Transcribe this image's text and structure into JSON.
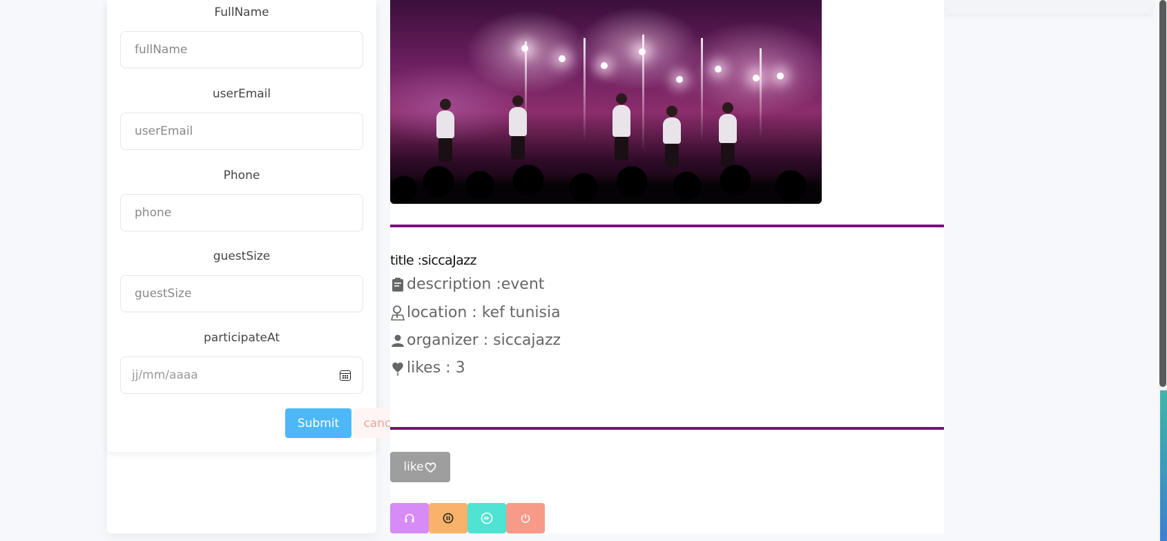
{
  "form": {
    "fields": [
      {
        "label": "FullName",
        "placeholder": "fullName"
      },
      {
        "label": "userEmail",
        "placeholder": "userEmail"
      },
      {
        "label": "Phone",
        "placeholder": "phone"
      },
      {
        "label": "guestSize",
        "placeholder": "guestSize"
      },
      {
        "label": "participateAt",
        "placeholder": "jj/mm/aaaa"
      }
    ],
    "submit_label": "Submit",
    "cancel_label": "cancle"
  },
  "event": {
    "image_alt": "concert",
    "title": "title :siccaJazz",
    "description": "description :event",
    "location": "location : kef tunisia",
    "organizer": "organizer : siccajazz",
    "likes": "likes : 3",
    "like_label": "like"
  },
  "media_controls": [
    {
      "icon": "headphones-icon",
      "color": "#d78bf5"
    },
    {
      "icon": "pause-icon",
      "color": "#f9b26b"
    },
    {
      "icon": "fast-forward-icon",
      "color": "#4ee3d2"
    },
    {
      "icon": "power-icon",
      "color": "#f79a88"
    }
  ],
  "colors": {
    "accent_rule": "#7b0a82",
    "submit": "#4db8f8",
    "cancel_text": "#f3a49a",
    "like_button": "#9e9e9e"
  }
}
